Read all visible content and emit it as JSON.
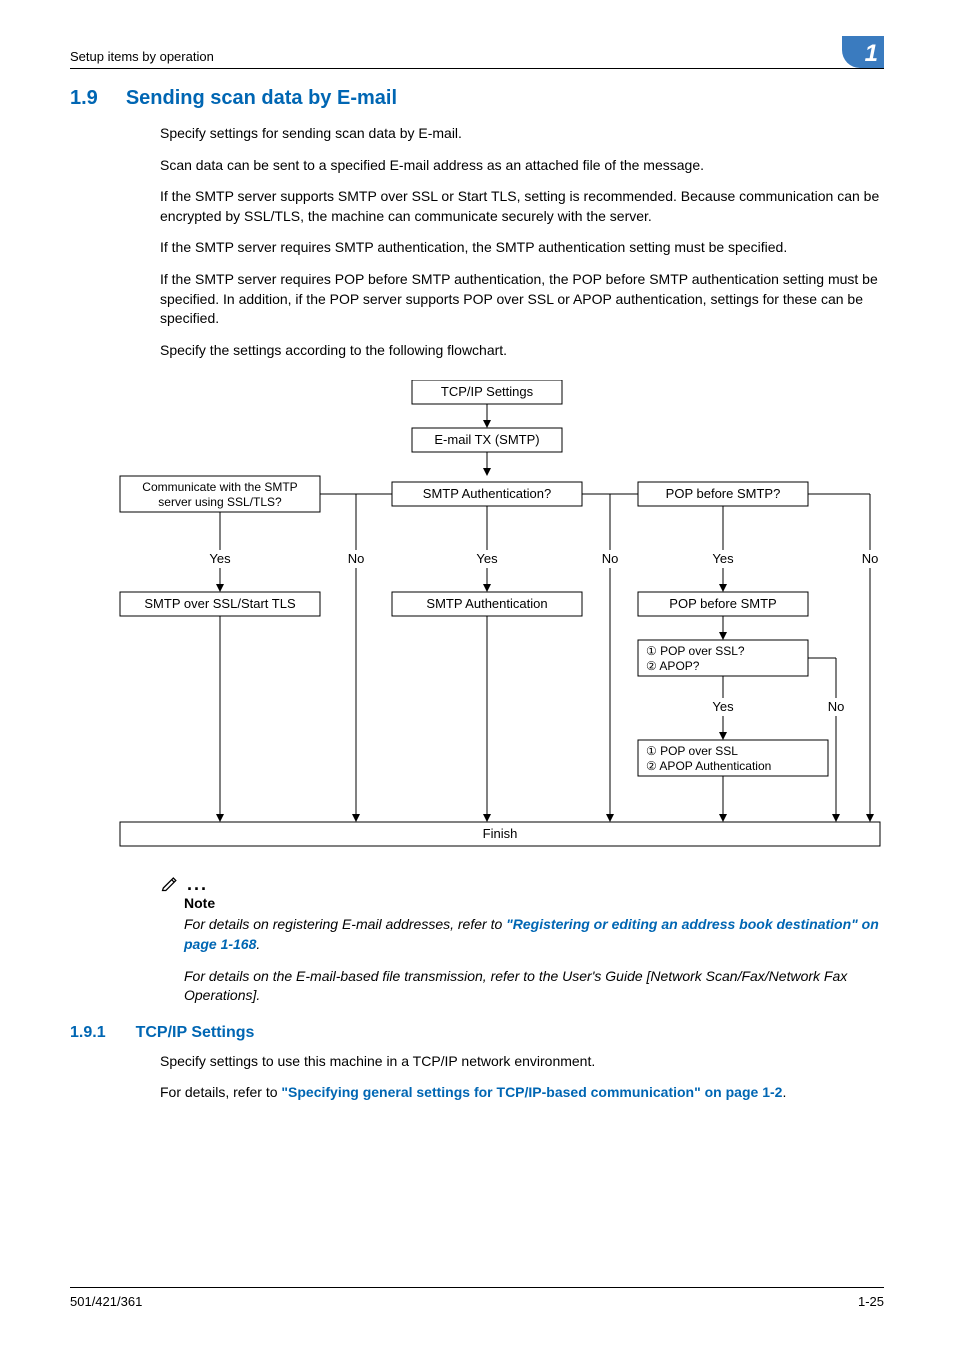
{
  "header": {
    "left": "Setup items by operation",
    "chapter": "1"
  },
  "section": {
    "num": "1.9",
    "title": "Sending scan data by E-mail"
  },
  "paras": {
    "p1": "Specify settings for sending scan data by E-mail.",
    "p2": "Scan data can be sent to a specified E-mail address as an attached file of the message.",
    "p3": "If the SMTP server supports SMTP over SSL or Start TLS, setting is recommended. Because communication can be encrypted by SSL/TLS, the machine can communicate securely with the server.",
    "p4": "If the SMTP server requires SMTP authentication, the SMTP authentication setting must be specified.",
    "p5": "If the SMTP server requires POP before SMTP authentication, the POP before SMTP authentication setting must be specified. In addition, if the POP server supports POP over SSL or APOP authentication, settings for these can be specified.",
    "p6": "Specify the settings according to the following flowchart."
  },
  "flow": {
    "tcpip": "TCP/IP Settings",
    "email_tx": "E-mail TX (SMTP)",
    "q_ssl_l1": "Communicate with the SMTP",
    "q_ssl_l2": "server using SSL/TLS?",
    "q_smtpauth": "SMTP Authentication?",
    "q_popbefore": "POP before SMTP?",
    "yes": "Yes",
    "no": "No",
    "a_ssl": "SMTP over SSL/Start TLS",
    "a_smtpauth": "SMTP Authentication",
    "a_popbefore": "POP before SMTP",
    "q_popssl": "① POP over SSL?",
    "q_apop": "② APOP?",
    "a_popssl": "① POP over SSL",
    "a_apop": "② APOP Authentication",
    "finish": "Finish"
  },
  "note": {
    "label": "Note",
    "n1_a": "For details on registering E-mail addresses, refer to ",
    "n1_link": "\"Registering or editing an address book destination\" on page 1-168",
    "n1_c": ".",
    "n2": "For details on the E-mail-based file transmission, refer to the User's Guide [Network Scan/Fax/Network Fax Operations]."
  },
  "subsection": {
    "num": "1.9.1",
    "title": "TCP/IP Settings",
    "p1": "Specify settings to use this machine in a TCP/IP network environment.",
    "p2a": "For details, refer to ",
    "p2link": "\"Specifying general settings for TCP/IP-based communication\" on page 1-2",
    "p2c": "."
  },
  "footer": {
    "left": "501/421/361",
    "right": "1-25"
  }
}
